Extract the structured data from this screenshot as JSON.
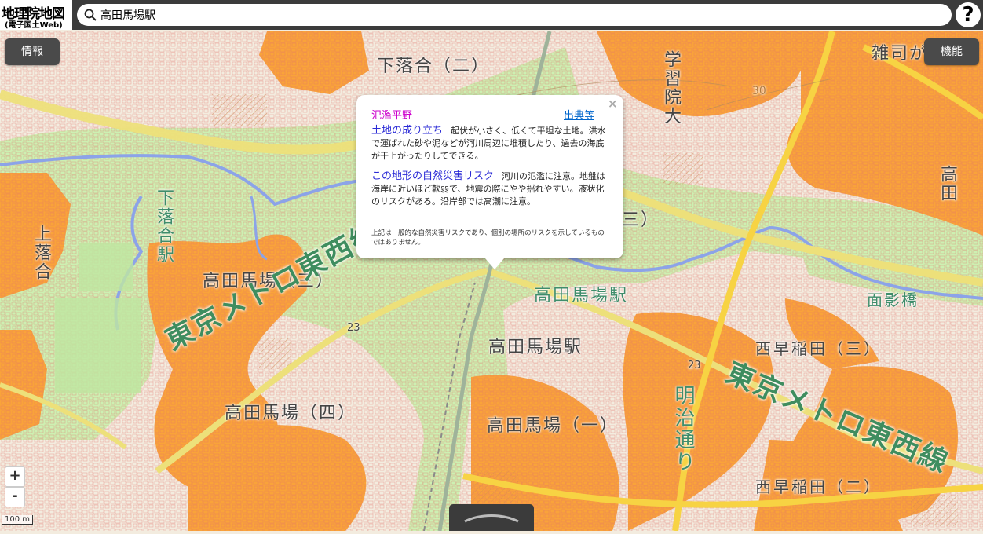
{
  "header": {
    "logo_title": "地理院地図",
    "logo_subtitle": "(電子国土Web)",
    "search_value": "高田馬場駅",
    "help_label": "?"
  },
  "buttons": {
    "info_label": "情報",
    "function_label": "機能",
    "zoom_in_label": "+",
    "zoom_out_label": "-"
  },
  "scale_label": "100 m",
  "popup": {
    "title": "氾濫平野",
    "source_link": "出典等",
    "close_label": "×",
    "origin_heading": "土地の成り立ち",
    "origin_text": "起伏が小さく、低くて平坦な土地。洪水で運ばれた砂や泥などが河川周辺に堆積したり、過去の海底が干上がったりしてできる。",
    "risk_heading": "この地形の自然災害リスク",
    "risk_text": "河川の氾濫に注意。地盤は海岸に近いほど軟弱で、地震の際にやや揺れやすい。液状化のリスクがある。沿岸部では高潮に注意。",
    "note": "上記は一般的な自然災害リスクであり、個別の場所のリスクを示しているものではありません。"
  },
  "map_labels": {
    "shimoochiai_2": "下落合（二）",
    "gakushuin": "学習院大",
    "zoshigaya": "雑司が",
    "takata_right": "高田",
    "kami_ochiai": "上落合",
    "shimo_ochiai_station": "下落合駅",
    "takadanobaba_3": "高田馬場（三）",
    "takadanobaba_station_green": "高田馬場駅",
    "takadanobaba_station": "高田馬場駅",
    "nishiwaseda_3": "西早稲田（三）",
    "takadanobaba_4": "高田馬場（四）",
    "takadanobaba_1": "高田馬場（一）",
    "nishiwaseda_2": "西早稲田（二）",
    "meiji_dori": "明治通り",
    "omokagebashi": "面影橋",
    "tozai_left": "東京メトロ東西線",
    "tozai_right": "東京メトロ東西線",
    "route_23_a": "23",
    "route_23_b": "23",
    "contour_30": "30",
    "san_paren": "三）"
  },
  "colors": {
    "background": "#f3ecdf",
    "flood_plain": "#cdf0b2",
    "terrace": "#f9a33a",
    "river": "#8ca3e8",
    "road_major": "#ede07a",
    "road_yellow": "#f7d343",
    "popup_title": "#cc00cc",
    "popup_heading": "#2a2ad6"
  }
}
